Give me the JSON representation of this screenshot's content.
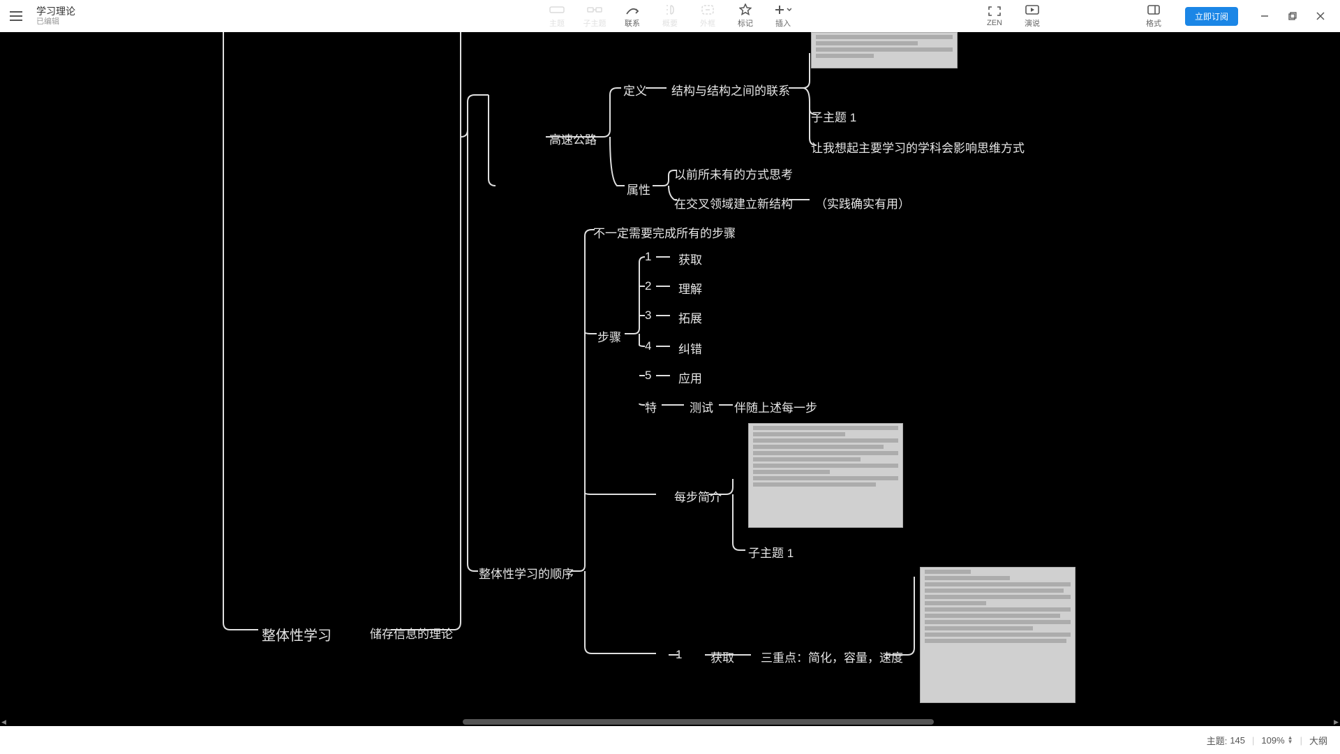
{
  "header": {
    "doc_title": "学习理论",
    "doc_status": "已编辑"
  },
  "toolbar": {
    "topic": "主题",
    "subtopic": "子主题",
    "relation": "联系",
    "summary": "概要",
    "boundary": "外框",
    "marker": "标记",
    "insert": "插入",
    "zen": "ZEN",
    "present": "演说",
    "format": "格式",
    "subscribe": "立即订阅"
  },
  "mindmap": {
    "root": "整体性学习",
    "n_storage": "储存信息的理论",
    "n_highway": "高速公路",
    "n_def": "定义",
    "n_def_v": "结构与结构之间的联系",
    "n_def_sub1": "子主题 1",
    "n_def_sub2": "让我想起主要学习的学科会影响思维方式",
    "n_attr": "属性",
    "n_attr1": "以前所未有的方式思考",
    "n_attr2": "在交叉领域建立新结构",
    "n_attr2_note": "（实践确实有用）",
    "n_order": "整体性学习的顺序",
    "n_order_note": "不一定需要完成所有的步骤",
    "n_steps": "步骤",
    "s1": "1",
    "s1v": "获取",
    "s2": "2",
    "s2v": "理解",
    "s3": "3",
    "s3v": "拓展",
    "s4": "4",
    "s4v": "纠错",
    "s5": "5",
    "s5v": "应用",
    "s6": "特",
    "s6v": "测试",
    "s6n": "伴随上述每一步",
    "n_brief": "每步简介",
    "n_brief_sub": "子主题 1",
    "n_one": "1",
    "n_one_v": "获取",
    "n_one_n": "三重点：简化，容量，速度"
  },
  "status": {
    "topic_label": "主题:",
    "topic_count": "145",
    "zoom": "109%",
    "outline": "大纲"
  }
}
